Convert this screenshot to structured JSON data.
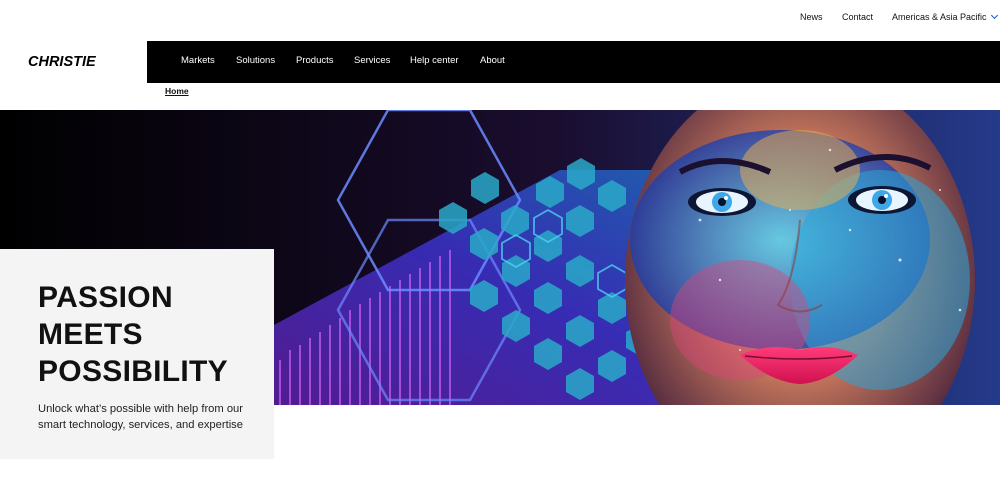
{
  "utility_nav": {
    "news": "News",
    "contact": "Contact",
    "region": "Americas & Asia Pacific"
  },
  "logo": {
    "text": "CHRISTIE"
  },
  "main_nav": {
    "items": [
      "Markets",
      "Solutions",
      "Products",
      "Services",
      "Help center",
      "About"
    ]
  },
  "breadcrumb": {
    "home": "Home"
  },
  "hero": {
    "title_lines": [
      "PASSION",
      "MEETS",
      "POSSIBILITY"
    ],
    "subtitle": "Unlock what’s possible with help from our smart technology, services, and expertise"
  },
  "colors": {
    "nav_background": "#000000",
    "card_background": "#f4f4f4",
    "accent_chevron": "#1a56c4",
    "hex_cyan": "#2aa9c9",
    "hex_purple": "#6a3fd6"
  },
  "icons": {
    "region_dropdown": "chevron-down-icon"
  }
}
